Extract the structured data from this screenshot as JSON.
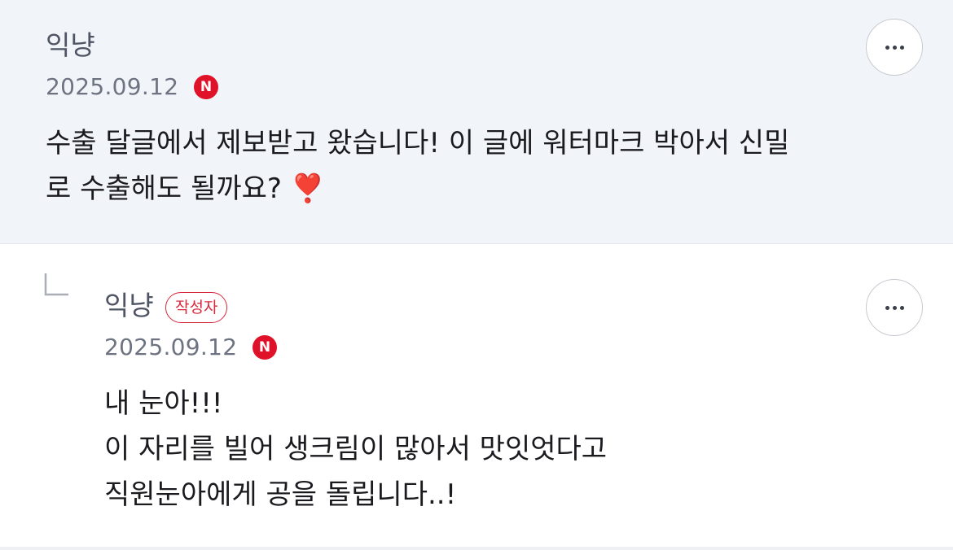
{
  "comments": [
    {
      "author": "익냥",
      "date": "2025.09.12",
      "badge": "N",
      "body_line1": "수출 달글에서 제보받고 왔습니다! 이 글에 워터마크 박아서 신밀",
      "body_line2": "로 수출해도 될까요?",
      "emoji": "❣️",
      "more_icon": "more-dots-icon"
    },
    {
      "author": "익냥",
      "author_tag": "작성자",
      "date": "2025.09.12",
      "badge": "N",
      "body_lines": [
        "내 눈아!!!",
        "이 자리를 빌어 생크림이 많아서 맛잇엇다고",
        "직원눈아에게 공을 돌립니다..!"
      ],
      "more_icon": "more-dots-icon",
      "reply_icon": "reply-arrow-icon"
    }
  ],
  "colors": {
    "highlight_bg": "#f1f5fa",
    "badge_red": "#e0122a",
    "writer_tag": "#d8283c"
  }
}
